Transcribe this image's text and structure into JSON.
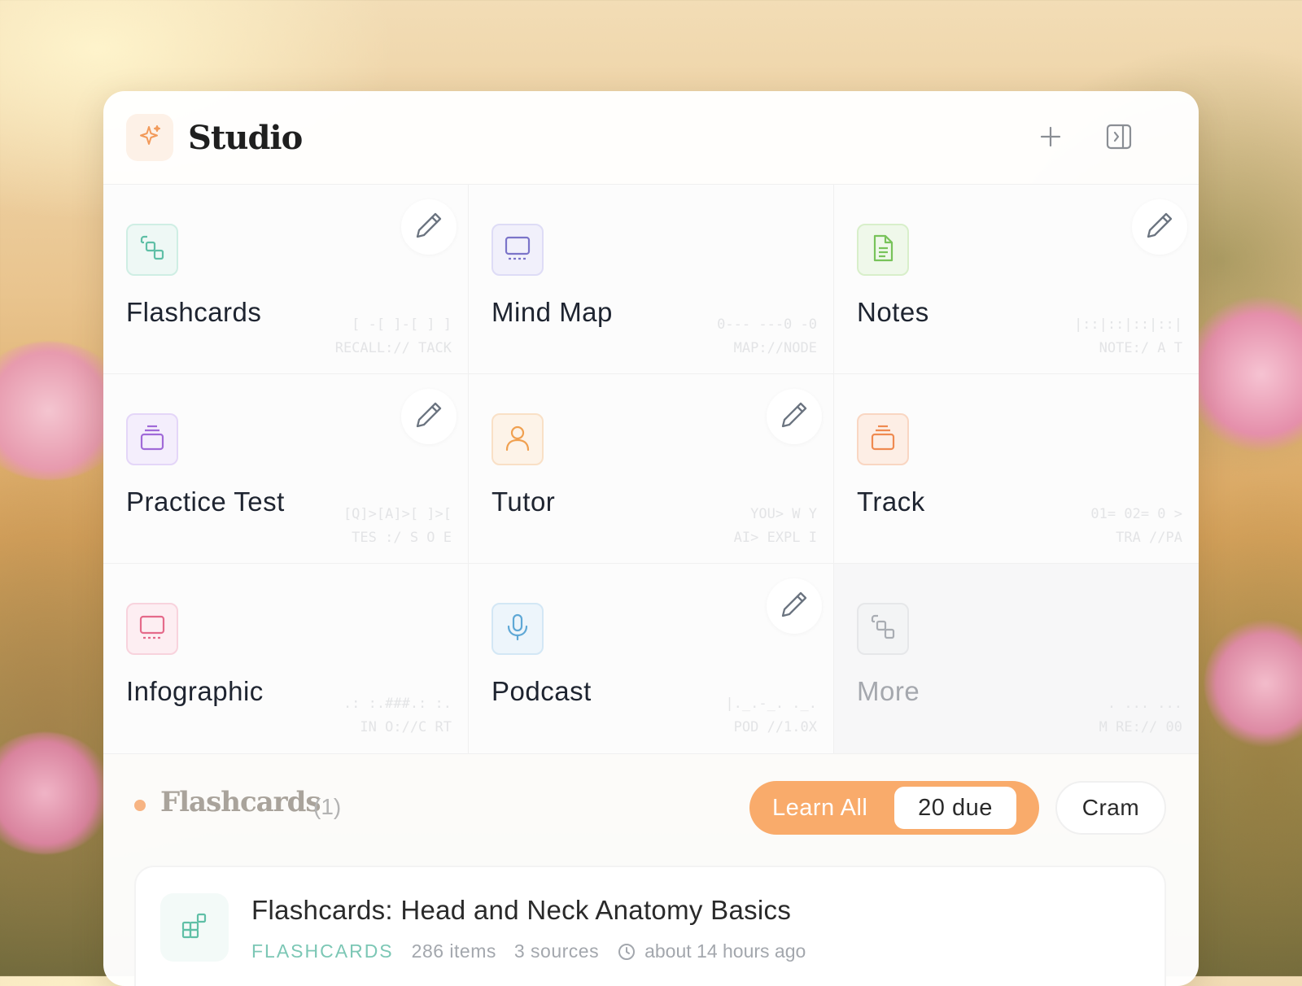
{
  "studio": {
    "title": "Studio",
    "add_icon": "plus-icon",
    "panel_icon": "sidebar-toggle-icon"
  },
  "tools": [
    {
      "label": "Flashcards",
      "icon": "cards-icon",
      "color": "#5fbfa6",
      "bg": "#eef8f5",
      "editable": true,
      "code1": "[ -[ ]-[ ] ]",
      "code2": "RECALL:// TACK"
    },
    {
      "label": "Mind Map",
      "icon": "monitor-icon",
      "color": "#7b74c9",
      "bg": "#f1f0fb",
      "editable": false,
      "code1": "0--- ---0 -0",
      "code2": "MAP://NODE"
    },
    {
      "label": "Notes",
      "icon": "document-icon",
      "color": "#78c35a",
      "bg": "#eff8ea",
      "editable": true,
      "code1": "|::|::|::|::|",
      "code2": "NOTE:/ A T"
    },
    {
      "label": "Practice Test",
      "icon": "stack-icon",
      "color": "#a06ad8",
      "bg": "#f4eefc",
      "editable": true,
      "code1": "[Q]>[A]>[ ]>[",
      "code2": "TES :/ S O E"
    },
    {
      "label": "Tutor",
      "icon": "person-icon",
      "color": "#f0a050",
      "bg": "#fdf3e8",
      "editable": true,
      "code1": "YOU> W Y",
      "code2": "AI> EXPL I"
    },
    {
      "label": "Track",
      "icon": "stack-icon",
      "color": "#ef8a50",
      "bg": "#fdeee5",
      "editable": false,
      "code1": "01= 02= 0 >",
      "code2": "TRA //PA"
    },
    {
      "label": "Infographic",
      "icon": "monitor-icon",
      "color": "#e56a8a",
      "bg": "#fdeef2",
      "editable": false,
      "code1": ".: :.###.: :.",
      "code2": "IN O://C RT"
    },
    {
      "label": "Podcast",
      "icon": "microphone-icon",
      "color": "#5fa8d6",
      "bg": "#edf5fb",
      "editable": true,
      "code1": "|._.-_. ._.",
      "code2": "POD //1.0X"
    },
    {
      "label": "More",
      "icon": "cards-icon",
      "color": "#a9adb3",
      "bg": "#f3f4f5",
      "editable": false,
      "code1": ". ... ...",
      "code2": "M RE:// 00"
    }
  ],
  "section": {
    "title": "Flashcards",
    "count": "(1)",
    "learn_all": "Learn All",
    "due": "20 due",
    "cram": "Cram"
  },
  "deck": {
    "title": "Flashcards: Head and Neck Anatomy Basics",
    "type": "FLASHCARDS",
    "items": "286 items",
    "sources": "3 sources",
    "updated": "about 14 hours ago"
  }
}
